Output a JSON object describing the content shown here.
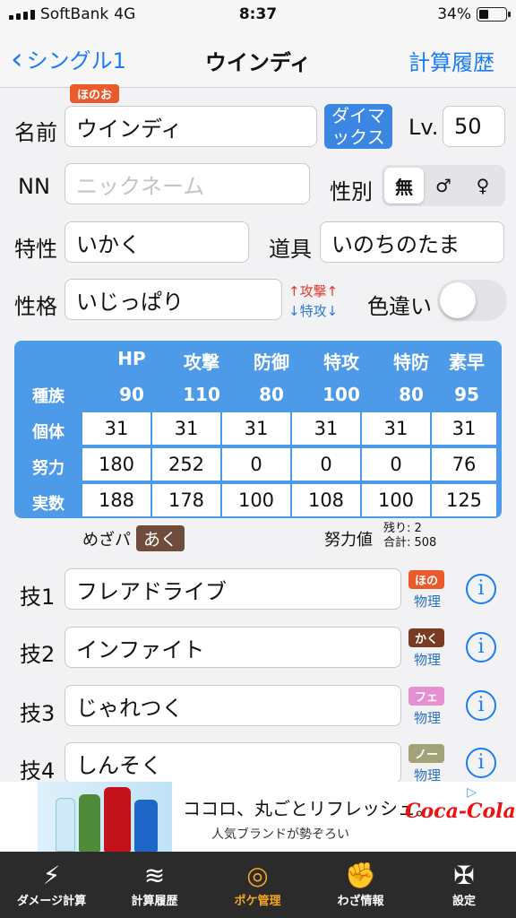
{
  "status": {
    "carrier": "SoftBank",
    "network": "4G",
    "time": "8:37",
    "battery": "34%",
    "battery_level": 0.34
  },
  "nav": {
    "back_label": "シングル1",
    "title": "ウインディ",
    "right_label": "計算履歴"
  },
  "form": {
    "type_badge": "ほのお",
    "name_label": "名前",
    "name_value": "ウインディ",
    "dynamax_label": "ダイマックス",
    "level_label": "Lv.",
    "level_value": "50",
    "nn_label": "NN",
    "nn_placeholder": "ニックネーム",
    "gender_label": "性別",
    "gender_options": [
      "無",
      "♂",
      "♀"
    ],
    "gender_selected": "無",
    "ability_label": "特性",
    "ability_value": "いかく",
    "item_label": "道具",
    "item_value": "いのちのたま",
    "nature_label": "性格",
    "nature_value": "いじっぱり",
    "nature_up": "↑攻撃↑",
    "nature_down": "↓特攻↓",
    "shiny_label": "色違い",
    "shiny_on": false
  },
  "stats": {
    "headers": [
      "HP",
      "攻撃",
      "防御",
      "特攻",
      "特防",
      "素早"
    ],
    "row_labels": {
      "base": "種族",
      "iv": "個体",
      "ev": "努力",
      "actual": "実数"
    },
    "base": [
      "90",
      "110",
      "80",
      "100",
      "80",
      "95"
    ],
    "iv": [
      "31",
      "31",
      "31",
      "31",
      "31",
      "31"
    ],
    "ev": [
      "180",
      "252",
      "0",
      "0",
      "0",
      "76"
    ],
    "actual": [
      "188",
      "178",
      "100",
      "108",
      "100",
      "125"
    ]
  },
  "hidden_power": {
    "label": "めざパ",
    "type": "あく"
  },
  "ev_summary": {
    "label": "努力値",
    "remaining": "残り: 2",
    "total": "合計: 508"
  },
  "moves": [
    {
      "label": "技1",
      "name": "フレアドライブ",
      "type": "ほの",
      "type_color": "#ea5a2a",
      "category": "物理"
    },
    {
      "label": "技2",
      "name": "インファイト",
      "type": "かく",
      "type_color": "#7a3b22",
      "category": "物理"
    },
    {
      "label": "技3",
      "name": "じゃれつく",
      "type": "フェ",
      "type_color": "#e58fd0",
      "category": "物理"
    },
    {
      "label": "技4",
      "name": "しんそく",
      "type": "ノー",
      "type_color": "#a3a37a",
      "category": "物理"
    }
  ],
  "ad": {
    "headline": "ココロ、丸ごとリフレッシュ。",
    "subline": "人気ブランドが勢ぞろい",
    "brand": "Coca-Cola"
  },
  "tabs": [
    {
      "label": "ダメージ計算",
      "icon": "lightning-icon"
    },
    {
      "label": "計算履歴",
      "icon": "wings-icon"
    },
    {
      "label": "ポケ管理",
      "icon": "ring-icon"
    },
    {
      "label": "わざ情報",
      "icon": "fist-icon"
    },
    {
      "label": "設定",
      "icon": "emblem-icon"
    }
  ],
  "active_tab": "ポケ管理"
}
